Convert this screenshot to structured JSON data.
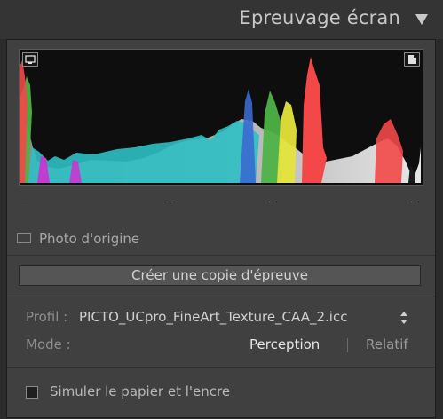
{
  "header": {
    "title": "Epreuvage écran",
    "collapse_icon": "triangle-down-icon"
  },
  "histogram": {
    "left_button_icon": "monitor-icon",
    "right_button_icon": "document-icon"
  },
  "original_photo": {
    "label": "Photo d'origine",
    "checked": false
  },
  "create_copy": {
    "label": "Créer une copie d'épreuve"
  },
  "profile": {
    "label": "Profil :",
    "value": "PICTO_UCpro_FineArt_Texture_CAA_2.icc",
    "stepper_icon": "updown-stepper-icon"
  },
  "mode": {
    "label": "Mode :",
    "options": [
      "Perception",
      "Relatif"
    ],
    "selected": "Perception"
  },
  "simulate": {
    "label": "Simuler le papier et l'encre",
    "checked": false
  },
  "colors": {
    "panel_bg": "#404040",
    "header_bg": "#343434",
    "histogram_bg": "#0e0e0e"
  }
}
